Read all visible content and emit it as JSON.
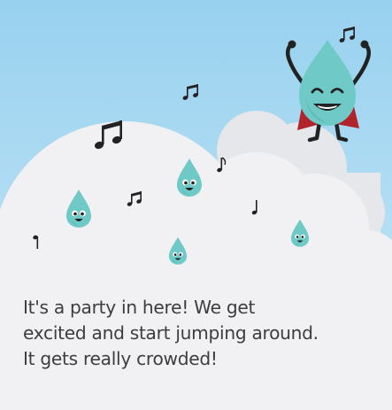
{
  "story": {
    "caption_lines": [
      "It's a party in here! We get",
      "excited and start jumping around.",
      "It gets really crowded!"
    ]
  },
  "colors": {
    "sky_top": "#98d1ef",
    "sky_bottom": "#c9e8f8",
    "cloud": "#f1f1f3",
    "cloud_back": "#e6e7ea",
    "drop_fill": "#6fcac7",
    "drop_shade": "#58b7b4",
    "cape": "#b2242b",
    "outline": "#222222",
    "caption_text": "#3d3d3d"
  },
  "icons": {
    "hero": "water-drop-hero-icon",
    "small_drop": "water-drop-icon",
    "beamed_note": "beamed-music-note-icon",
    "quarter_note": "quarter-note-icon"
  }
}
